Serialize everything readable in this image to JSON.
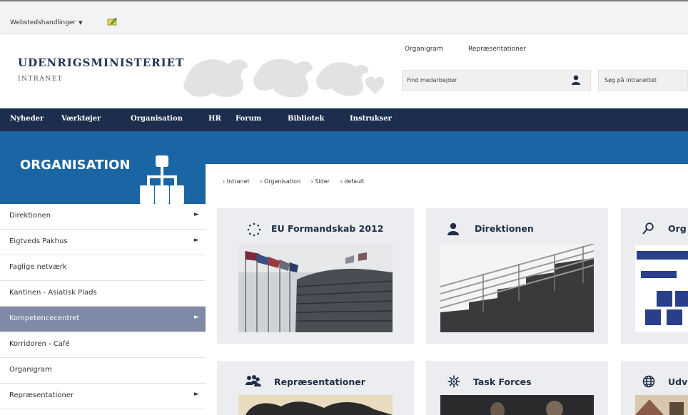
{
  "toolbar": {
    "site_actions": "Webstedshandlinger"
  },
  "header": {
    "logo_title": "UDENRIGSMINISTERIET",
    "logo_subtitle": "INTRANET",
    "links": [
      "Organigram",
      "Repræsentationer"
    ],
    "find_employee_placeholder": "Find medarbejder",
    "search_placeholder": "Søg på intranettet"
  },
  "nav": [
    "Nyheder",
    "Værktøjer",
    "Organisation",
    "HR",
    "Forum",
    "Bibliotek",
    "Instrukser"
  ],
  "section": {
    "title": "ORGANISATION"
  },
  "breadcrumb": [
    "Intranet",
    "Organisation",
    "Sider",
    "default"
  ],
  "sidebar": {
    "items": [
      {
        "label": "Direktionen",
        "has_arrow": true,
        "active": false
      },
      {
        "label": "Eigtveds Pakhus",
        "has_arrow": true,
        "active": false
      },
      {
        "label": "Faglige netværk",
        "has_arrow": false,
        "active": false
      },
      {
        "label": "Kantinen - Asiatisk Plads",
        "has_arrow": false,
        "active": false
      },
      {
        "label": "Kompetencecentret",
        "has_arrow": true,
        "active": true
      },
      {
        "label": "Korridoren - Café",
        "has_arrow": false,
        "active": false
      },
      {
        "label": "Organigram",
        "has_arrow": false,
        "active": false
      },
      {
        "label": "Repræsentationer",
        "has_arrow": true,
        "active": false
      }
    ]
  },
  "cards": [
    {
      "title": "EU Formandskab 2012",
      "icon": "circle-dots-icon"
    },
    {
      "title": "Direktionen",
      "icon": "person-icon"
    },
    {
      "title": "Org",
      "icon": "magnifier-icon"
    },
    {
      "title": "Repræsentationer",
      "icon": "people-icon"
    },
    {
      "title": "Task Forces",
      "icon": "gear-icon"
    },
    {
      "title": "Udv",
      "icon": "globe-icon"
    }
  ],
  "colors": {
    "nav_bg": "#1d2d4d",
    "banner_bg": "#1a65a4",
    "active_item": "#7e8aa6",
    "card_bg": "#ecedf0"
  }
}
